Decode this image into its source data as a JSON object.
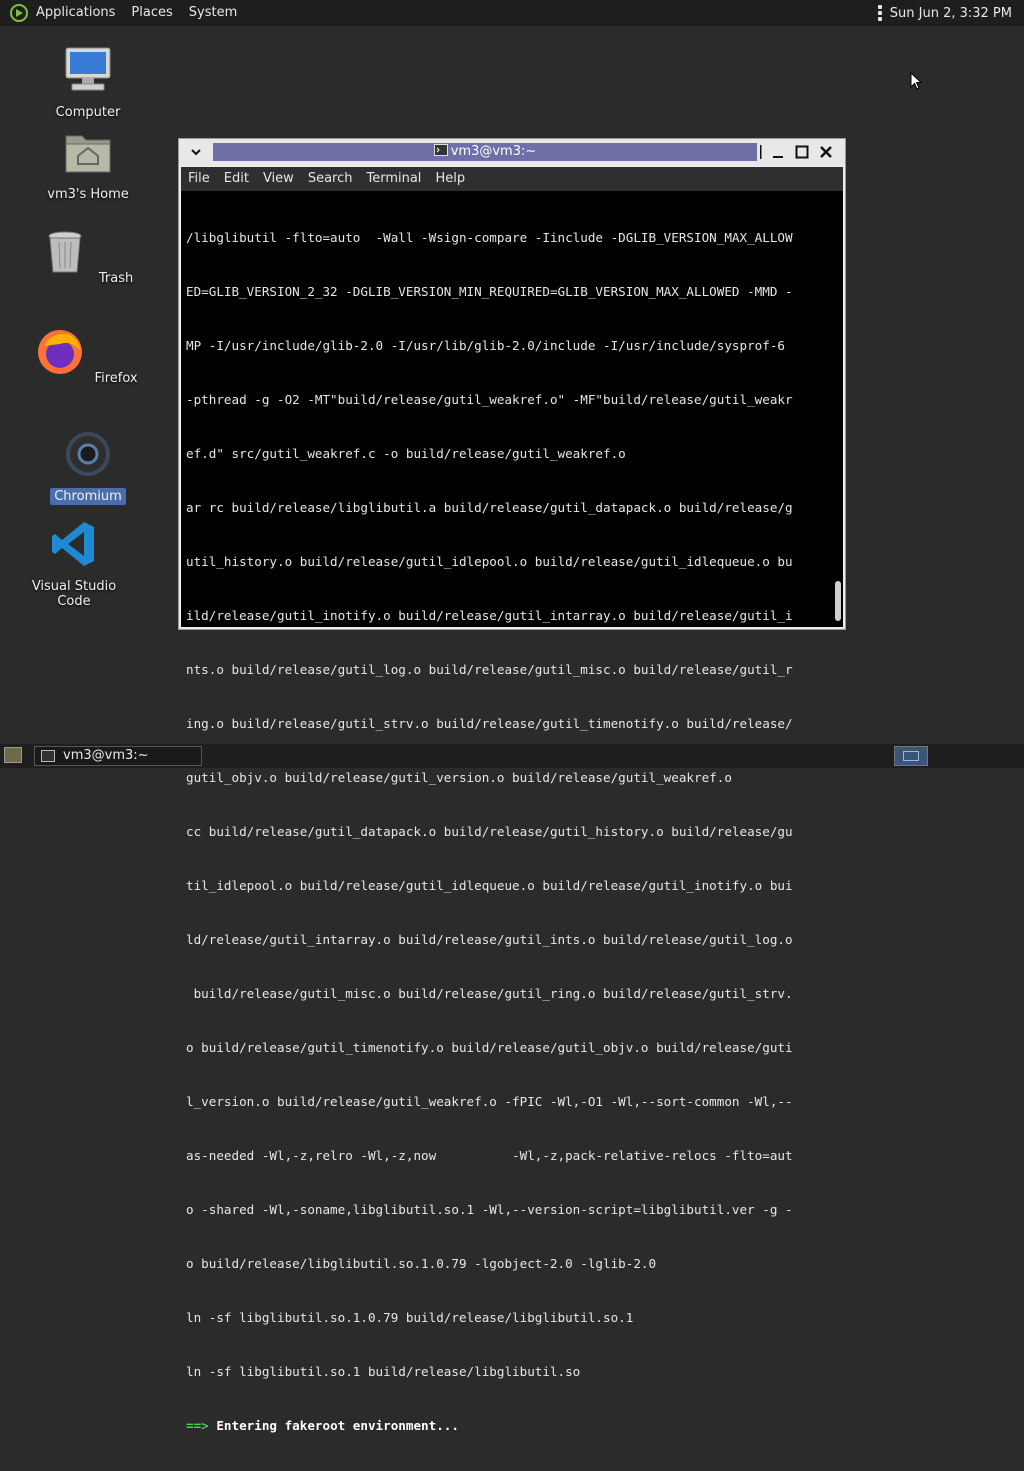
{
  "top_panel": {
    "menus": [
      "Applications",
      "Places",
      "System"
    ],
    "clock": "Sun Jun  2,  3:32 PM"
  },
  "desktop": {
    "icons": [
      {
        "label": "Computer"
      },
      {
        "label": "vm3's Home"
      },
      {
        "label": "Trash"
      },
      {
        "label": "Firefox"
      },
      {
        "label": "Chromium"
      },
      {
        "label": "Visual Studio Code"
      }
    ]
  },
  "terminal": {
    "title": "vm3@vm3:~",
    "menus": [
      "File",
      "Edit",
      "View",
      "Search",
      "Terminal",
      "Help"
    ],
    "lines": [
      "/libglibutil -flto=auto  -Wall -Wsign-compare -Iinclude -DGLIB_VERSION_MAX_ALLOW",
      "ED=GLIB_VERSION_2_32 -DGLIB_VERSION_MIN_REQUIRED=GLIB_VERSION_MAX_ALLOWED -MMD -",
      "MP -I/usr/include/glib-2.0 -I/usr/lib/glib-2.0/include -I/usr/include/sysprof-6",
      "-pthread -g -O2 -MT\"build/release/gutil_weakref.o\" -MF\"build/release/gutil_weakr",
      "ef.d\" src/gutil_weakref.c -o build/release/gutil_weakref.o",
      "ar rc build/release/libglibutil.a build/release/gutil_datapack.o build/release/g",
      "util_history.o build/release/gutil_idlepool.o build/release/gutil_idlequeue.o bu",
      "ild/release/gutil_inotify.o build/release/gutil_intarray.o build/release/gutil_i",
      "nts.o build/release/gutil_log.o build/release/gutil_misc.o build/release/gutil_r",
      "ing.o build/release/gutil_strv.o build/release/gutil_timenotify.o build/release/",
      "gutil_objv.o build/release/gutil_version.o build/release/gutil_weakref.o",
      "cc build/release/gutil_datapack.o build/release/gutil_history.o build/release/gu",
      "til_idlepool.o build/release/gutil_idlequeue.o build/release/gutil_inotify.o bui",
      "ld/release/gutil_intarray.o build/release/gutil_ints.o build/release/gutil_log.o",
      " build/release/gutil_misc.o build/release/gutil_ring.o build/release/gutil_strv.",
      "o build/release/gutil_timenotify.o build/release/gutil_objv.o build/release/guti",
      "l_version.o build/release/gutil_weakref.o -fPIC -Wl,-O1 -Wl,--sort-common -Wl,--",
      "as-needed -Wl,-z,relro -Wl,-z,now          -Wl,-z,pack-relative-relocs -flto=aut",
      "o -shared -Wl,-soname,libglibutil.so.1 -Wl,--version-script=libglibutil.ver -g -",
      "o build/release/libglibutil.so.1.0.79 -lgobject-2.0 -lglib-2.0",
      "ln -sf libglibutil.so.1.0.79 build/release/libglibutil.so.1",
      "ln -sf libglibutil.so.1 build/release/libglibutil.so"
    ],
    "last_line": {
      "arrow": "==>",
      "message": " Entering fakeroot environment..."
    }
  },
  "bottom_panel": {
    "task_label": "vm3@vm3:~"
  },
  "colors": {
    "desktop_bg": "#2b2b2b",
    "panel_bg": "#1e1e1e",
    "title_strip": "#6f6fa8",
    "prompt_arrow": "#4ad04a",
    "selection": "#4a6ea9"
  }
}
